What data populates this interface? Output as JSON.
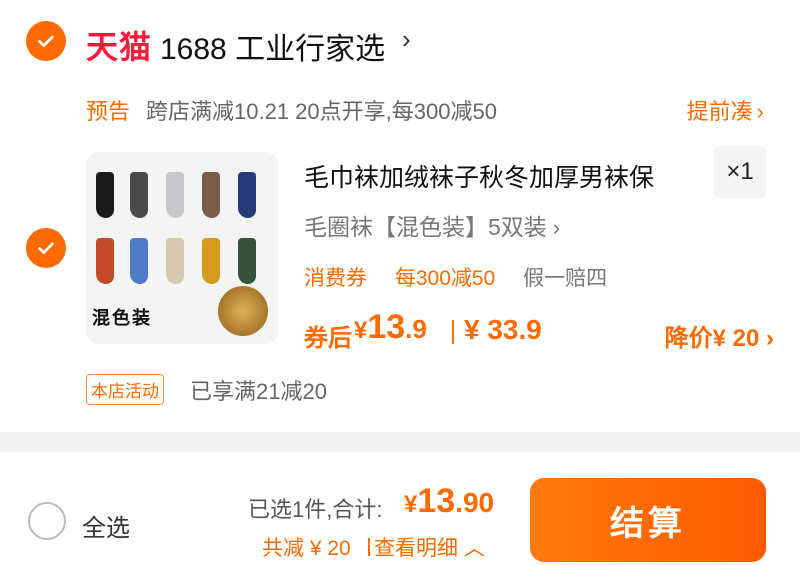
{
  "store": {
    "brand": "天猫",
    "name": "1688 工业行家选",
    "chevron": "›"
  },
  "promo": {
    "tag": "预告",
    "text": "跨店满减10.21 20点开享,每300减50",
    "link": "提前凑",
    "link_chevron": "›"
  },
  "item": {
    "title": "毛巾袜加绒袜子秋冬加厚男袜保",
    "quantity": "×1",
    "sku": "毛圈袜【混色装】5双装",
    "sku_chevron": "›",
    "thumb_caption": "混色装",
    "coupons": {
      "tag": "消费券",
      "rule": "每300减50",
      "guarantee": "假一赔四"
    },
    "price": {
      "after_label": "券后",
      "yen": "¥",
      "after_int": "13",
      "after_dec": ".9",
      "original": "¥ 33.9",
      "drop": "降价¥ 20 ›"
    },
    "activity": {
      "tag": "本店活动",
      "text": "已享满21减20"
    }
  },
  "bottom": {
    "select_all": "全选",
    "selected_summary": "已选1件,合计:",
    "total_yen": "¥",
    "total_int": "13",
    "total_dec": ".90",
    "discount": "共减 ¥ 20",
    "detail": "查看明细 ︿",
    "checkout": "结算"
  },
  "colors": {
    "accent": "#ff6a00",
    "brand_red": "#ff1a3c"
  }
}
